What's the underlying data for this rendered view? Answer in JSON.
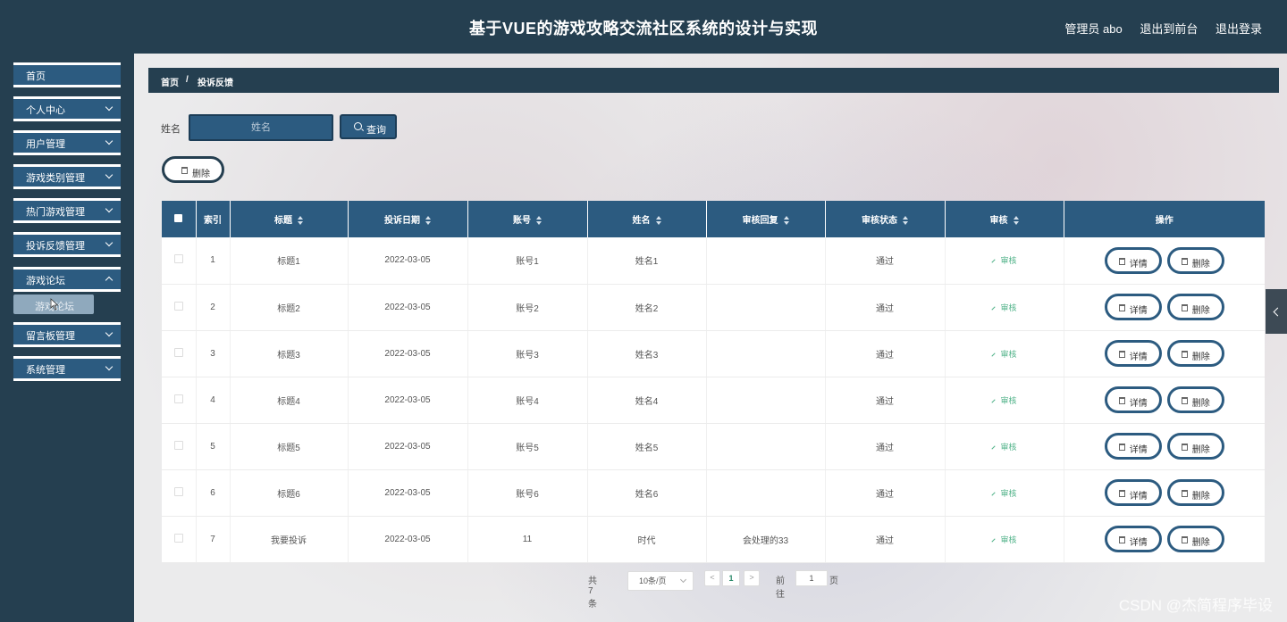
{
  "header": {
    "title": "基于VUE的游戏攻略交流社区系统的设计与实现",
    "admin_label": "管理员 abo",
    "front_link": "退出到前台",
    "logout_link": "退出登录"
  },
  "sidebar": {
    "items": [
      {
        "label": "首页"
      },
      {
        "label": "个人中心"
      },
      {
        "label": "用户管理"
      },
      {
        "label": "游戏类别管理"
      },
      {
        "label": "热门游戏管理"
      },
      {
        "label": "投诉反馈管理"
      },
      {
        "label": "游戏论坛"
      },
      {
        "label": "留言板管理"
      },
      {
        "label": "系统管理"
      }
    ],
    "submenu_label": "游戏论坛"
  },
  "breadcrumb": {
    "home": "首页",
    "sep": "/",
    "current": "投诉反馈"
  },
  "search": {
    "label": "姓名",
    "placeholder": "姓名",
    "button": "查询"
  },
  "toolbar": {
    "delete_label": "删除"
  },
  "table": {
    "columns": [
      "索引",
      "标题",
      "投诉日期",
      "账号",
      "姓名",
      "审核回复",
      "审核状态",
      "审核",
      "操作"
    ],
    "audit_label": "审核",
    "detail_label": "详情",
    "delete_label": "删除",
    "rows": [
      {
        "index": "1",
        "title": "标题1",
        "date": "2022-03-05",
        "account": "账号1",
        "name": "姓名1",
        "reply": "",
        "status": "通过"
      },
      {
        "index": "2",
        "title": "标题2",
        "date": "2022-03-05",
        "account": "账号2",
        "name": "姓名2",
        "reply": "",
        "status": "通过"
      },
      {
        "index": "3",
        "title": "标题3",
        "date": "2022-03-05",
        "account": "账号3",
        "name": "姓名3",
        "reply": "",
        "status": "通过"
      },
      {
        "index": "4",
        "title": "标题4",
        "date": "2022-03-05",
        "account": "账号4",
        "name": "姓名4",
        "reply": "",
        "status": "通过"
      },
      {
        "index": "5",
        "title": "标题5",
        "date": "2022-03-05",
        "account": "账号5",
        "name": "姓名5",
        "reply": "",
        "status": "通过"
      },
      {
        "index": "6",
        "title": "标题6",
        "date": "2022-03-05",
        "account": "账号6",
        "name": "姓名6",
        "reply": "",
        "status": "通过"
      },
      {
        "index": "7",
        "title": "我要投诉",
        "date": "2022-03-05",
        "account": "11",
        "name": "时代",
        "reply": "会处理的33",
        "status": "通过"
      }
    ]
  },
  "pagination": {
    "total": "共 7 条",
    "page_size": "10条/页",
    "prev": "<",
    "current_page": "1",
    "next": ">",
    "goto_label": "前往",
    "goto_value": "1",
    "page_suffix": "页"
  },
  "watermark": "CSDN @杰简程序毕设",
  "colors": {
    "header_bg": "#253f50",
    "accent": "#2c5b80",
    "audit_green": "#52b38a"
  }
}
